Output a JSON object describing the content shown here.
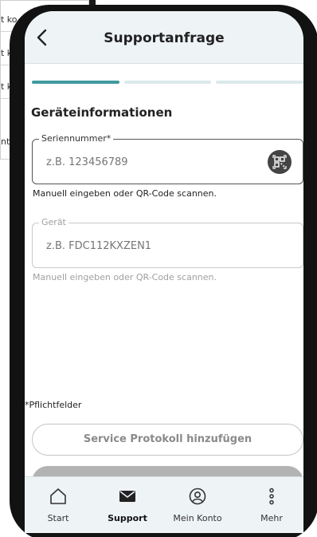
{
  "background": {
    "rows": [
      "t ko",
      "t k",
      "t k",
      "nto"
    ]
  },
  "header": {
    "title": "Supportanfrage"
  },
  "progress": {
    "total_steps": 3,
    "current_step": 1,
    "active_color": "#3f9aa0",
    "inactive_color": "#dbe9ec"
  },
  "section": {
    "title": "Geräteinformationen"
  },
  "serial_field": {
    "label": "Seriennummer*",
    "placeholder": "z.B. 123456789",
    "hint": "Manuell eingeben oder QR-Code scannen.",
    "icon": "qr-code-icon"
  },
  "device_field": {
    "label": "Gerät",
    "placeholder": "z.B. FDC112KXZEN1",
    "hint": "Manuell eingeben oder QR-Code scannen."
  },
  "required_note": "*Pflichtfelder",
  "actions": {
    "add_protocol_label": "Service Protokoll hinzufügen",
    "submit_label": ""
  },
  "tabbar": {
    "items": [
      {
        "label": "Start",
        "icon": "home-icon",
        "active": false
      },
      {
        "label": "Support",
        "icon": "mail-icon",
        "active": true
      },
      {
        "label": "Mein Konto",
        "icon": "user-icon",
        "active": false
      },
      {
        "label": "Mehr",
        "icon": "more-vertical-icon",
        "active": false
      }
    ]
  }
}
